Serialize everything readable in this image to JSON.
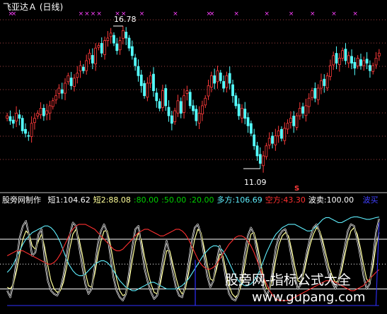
{
  "title_text": "飞亚达Ａ (日线)",
  "colors": {
    "background": "#000000",
    "candle_up": "#ff3b3b",
    "candle_down": "#54ffff",
    "x_marker": "#ff40ff",
    "level_line": "#ffffff",
    "series_short1": "#ffffff",
    "series_short2": "#ffff99",
    "series_duo": "#5ff0ff",
    "series_kong": "#ff3030",
    "series_bomai": "#3030ff",
    "separator": "#c0c0c0",
    "grid": "#a04040"
  },
  "annotations": {
    "high_label": "16.78",
    "low_label": "11.09",
    "s_marker": "S"
  },
  "indicator": {
    "name": "股旁网制作",
    "items": [
      {
        "label": "短1:",
        "value": "104.62",
        "color": "#ffffff"
      },
      {
        "label": "短2:",
        "value": "88.08",
        "color": "#ffff99"
      },
      {
        "label": ":",
        "value": "80.00",
        "color": "#00d000"
      },
      {
        "label": ":",
        "value": "50.00",
        "color": "#00d000"
      },
      {
        "label": ":",
        "value": "20.00",
        "color": "#00d000"
      },
      {
        "label": "多方:",
        "value": "106.69",
        "color": "#5ff0ff"
      },
      {
        "label": "空方:",
        "value": "43.30",
        "color": "#ff3030"
      },
      {
        "label": "波卖:",
        "value": "100.00",
        "color": "#ffffff"
      }
    ],
    "extra_label": "波买"
  },
  "watermark": {
    "line1": "股旁网-指标公式大全",
    "line2": "www.gupang.com"
  },
  "chart_data": [
    {
      "type": "candlestick",
      "title": "飞亚达Ａ (日线)",
      "xlabel": "",
      "ylabel": "",
      "ylim": [
        10.5,
        17.2
      ],
      "grid": true,
      "annotated_high": 16.78,
      "annotated_low": 11.09,
      "closes": [
        13.2,
        13.0,
        12.9,
        13.3,
        13.1,
        12.6,
        12.5,
        12.4,
        12.9,
        13.1,
        13.3,
        13.5,
        13.2,
        13.4,
        13.6,
        13.8,
        14.0,
        14.3,
        14.1,
        14.5,
        14.8,
        14.4,
        14.7,
        14.9,
        15.2,
        15.0,
        15.4,
        15.7,
        15.3,
        15.9,
        16.0,
        15.7,
        16.2,
        16.3,
        16.5,
        16.1,
        15.8,
        16.2,
        16.6,
        16.3,
        15.9,
        15.6,
        15.2,
        14.8,
        14.4,
        14.0,
        14.5,
        14.8,
        14.2,
        13.8,
        13.5,
        14.2,
        13.6,
        13.2,
        12.9,
        13.4,
        13.8,
        13.3,
        14.0,
        14.2,
        13.6,
        13.4,
        13.0,
        13.3,
        13.6,
        13.9,
        14.4,
        14.8,
        14.5,
        15.0,
        14.6,
        14.3,
        14.8,
        14.5,
        14.0,
        13.6,
        13.2,
        13.5,
        13.1,
        12.8,
        12.5,
        12.0,
        11.6,
        11.3,
        11.6,
        12.0,
        12.3,
        12.1,
        12.4,
        12.6,
        12.3,
        12.7,
        12.9,
        13.1,
        12.8,
        13.2,
        13.5,
        13.3,
        13.6,
        13.9,
        14.2,
        13.9,
        14.3,
        14.6,
        14.4,
        14.8,
        15.2,
        15.6,
        15.3,
        15.5,
        15.8,
        15.4,
        15.6,
        15.3,
        15.1,
        15.5,
        15.2,
        15.4,
        15.3,
        15.0,
        15.2,
        15.5,
        15.7
      ]
    },
    {
      "type": "line",
      "title": "股旁网制作",
      "ylim": [
        0,
        120
      ],
      "reference_levels": [
        80,
        50,
        20
      ],
      "series": [
        {
          "name": "短1",
          "last_value": 104.62,
          "values": [
            18,
            10,
            28,
            55,
            82,
            96,
            102,
            84,
            60,
            64,
            86,
            92,
            55,
            30,
            18,
            14,
            12,
            20,
            36,
            60,
            84,
            100,
            96,
            72,
            48,
            26,
            14,
            20,
            46,
            74,
            90,
            98,
            88,
            60,
            34,
            18,
            10,
            6,
            14,
            40,
            70,
            92,
            96,
            70,
            44,
            28,
            16,
            8,
            12,
            34,
            60,
            78,
            62,
            40,
            22,
            12,
            10,
            24,
            50,
            76,
            94,
            98,
            86,
            60,
            36,
            22,
            30,
            52,
            72,
            56,
            32,
            14,
            8,
            6,
            14,
            34,
            62,
            84,
            94,
            86,
            64,
            40,
            22,
            12,
            20,
            44,
            70,
            84,
            90,
            92,
            80,
            58,
            36,
            20,
            26,
            46,
            66,
            82,
            94,
            98,
            88,
            70,
            52,
            36,
            28,
            20,
            30,
            48,
            70,
            90,
            98,
            96,
            80,
            60,
            36,
            20,
            26,
            56,
            88,
            104.62
          ]
        },
        {
          "name": "短2",
          "last_value": 88.08,
          "values": [
            22,
            20,
            26,
            42,
            62,
            80,
            90,
            86,
            72,
            68,
            78,
            86,
            70,
            48,
            30,
            20,
            16,
            18,
            28,
            46,
            68,
            86,
            92,
            80,
            62,
            40,
            24,
            22,
            38,
            60,
            78,
            90,
            90,
            74,
            52,
            32,
            18,
            12,
            14,
            30,
            54,
            76,
            88,
            78,
            58,
            40,
            26,
            16,
            14,
            26,
            46,
            66,
            66,
            50,
            34,
            20,
            14,
            20,
            38,
            60,
            80,
            92,
            88,
            70,
            50,
            32,
            30,
            44,
            62,
            60,
            42,
            24,
            14,
            10,
            14,
            26,
            48,
            70,
            86,
            88,
            74,
            54,
            34,
            20,
            20,
            34,
            56,
            74,
            84,
            88,
            84,
            68,
            48,
            30,
            28,
            40,
            58,
            74,
            86,
            94,
            90,
            78,
            62,
            46,
            36,
            28,
            30,
            42,
            60,
            78,
            90,
            94,
            86,
            70,
            50,
            32,
            28,
            46,
            72,
            88.08
          ]
        },
        {
          "name": "多方",
          "last_value": 106.69,
          "values": [
            40,
            44,
            50,
            58,
            66,
            74,
            80,
            84,
            88,
            90,
            92,
            94,
            96,
            96,
            94,
            90,
            84,
            76,
            66,
            56,
            48,
            42,
            38,
            36,
            36,
            38,
            42,
            46,
            50,
            52,
            54,
            54,
            52,
            48,
            42,
            36,
            30,
            26,
            22,
            20,
            18,
            18,
            20,
            22,
            24,
            26,
            28,
            28,
            26,
            24,
            22,
            20,
            20,
            20,
            20,
            22,
            24,
            28,
            32,
            38,
            44,
            50,
            56,
            62,
            66,
            70,
            72,
            72,
            70,
            66,
            60,
            52,
            44,
            36,
            30,
            26,
            24,
            24,
            26,
            30,
            36,
            44,
            54,
            64,
            72,
            80,
            86,
            90,
            94,
            96,
            98,
            98,
            98,
            96,
            94,
            92,
            90,
            90,
            92,
            96,
            100,
            104,
            106,
            106,
            104,
            102,
            100,
            100,
            102,
            104,
            106,
            107,
            107,
            106,
            105,
            104,
            104,
            105,
            106,
            106.69
          ]
        },
        {
          "name": "空方",
          "last_value": 43.3,
          "values": [
            60,
            62,
            64,
            66,
            66,
            66,
            64,
            62,
            60,
            58,
            56,
            54,
            52,
            50,
            50,
            52,
            56,
            62,
            70,
            78,
            86,
            92,
            96,
            98,
            98,
            98,
            96,
            94,
            92,
            88,
            84,
            80,
            76,
            72,
            68,
            66,
            66,
            68,
            72,
            76,
            80,
            84,
            88,
            90,
            92,
            92,
            90,
            88,
            86,
            84,
            84,
            86,
            88,
            90,
            92,
            92,
            90,
            86,
            80,
            72,
            64,
            56,
            50,
            46,
            44,
            44,
            46,
            50,
            56,
            62,
            68,
            74,
            78,
            82,
            84,
            84,
            82,
            78,
            72,
            64,
            54,
            44,
            34,
            26,
            18,
            12,
            8,
            6,
            6,
            6,
            6,
            8,
            10,
            12,
            14,
            16,
            18,
            20,
            22,
            24,
            26,
            28,
            30,
            30,
            30,
            28,
            26,
            24,
            22,
            20,
            18,
            18,
            20,
            22,
            24,
            28,
            32,
            36,
            40,
            43.3
          ]
        },
        {
          "name": "波卖",
          "last_value": 100.0,
          "values": [
            0,
            0,
            0,
            0,
            0,
            0,
            0,
            0,
            0,
            0,
            0,
            0,
            0,
            0,
            0,
            0,
            0,
            0,
            0,
            0,
            0,
            0,
            0,
            0,
            0,
            0,
            0,
            0,
            0,
            0,
            0,
            0,
            0,
            0,
            0,
            0,
            0,
            0,
            0,
            0,
            0,
            0,
            0,
            0,
            0,
            0,
            0,
            0,
            0,
            0,
            0,
            0,
            0,
            0,
            0,
            0,
            0,
            0,
            0,
            0,
            0,
            0,
            0,
            0,
            0,
            0,
            0,
            0,
            0,
            0,
            0,
            0,
            0,
            0,
            0,
            0,
            0,
            0,
            0,
            0,
            0,
            0,
            0,
            0,
            0,
            0,
            0,
            0,
            0,
            0,
            0,
            0,
            0,
            0,
            0,
            0,
            0,
            0,
            0,
            0,
            0,
            0,
            0,
            0,
            0,
            0,
            0,
            0,
            0,
            0,
            0,
            0,
            0,
            0,
            0,
            0,
            0,
            0,
            0,
            100
          ]
        },
        {
          "name": "波买",
          "values": [
            0,
            0,
            0,
            0,
            0,
            0,
            0,
            0,
            0,
            0,
            0,
            0,
            0,
            0,
            0,
            0,
            0,
            0,
            0,
            0,
            0,
            0,
            0,
            0,
            0,
            0,
            0,
            0,
            0,
            0,
            0,
            0,
            0,
            0,
            0,
            0,
            0,
            0,
            0,
            0,
            0,
            0,
            0,
            0,
            0,
            0,
            0,
            0,
            0,
            0,
            0,
            0,
            0,
            0,
            0,
            0,
            0,
            0,
            0,
            0,
            0,
            0,
            0,
            0,
            0,
            0,
            0,
            0,
            0,
            0,
            0,
            0,
            0,
            0,
            0,
            0,
            0,
            0,
            0,
            0,
            0,
            0,
            0,
            0,
            0,
            0,
            0,
            0,
            0,
            0,
            0,
            0,
            0,
            0,
            0,
            0,
            0,
            0,
            0,
            0,
            0,
            0,
            0,
            0,
            0,
            0,
            0,
            0,
            0,
            0,
            0,
            0,
            0,
            0,
            0,
            0,
            0,
            0,
            0,
            0
          ]
        }
      ]
    }
  ]
}
